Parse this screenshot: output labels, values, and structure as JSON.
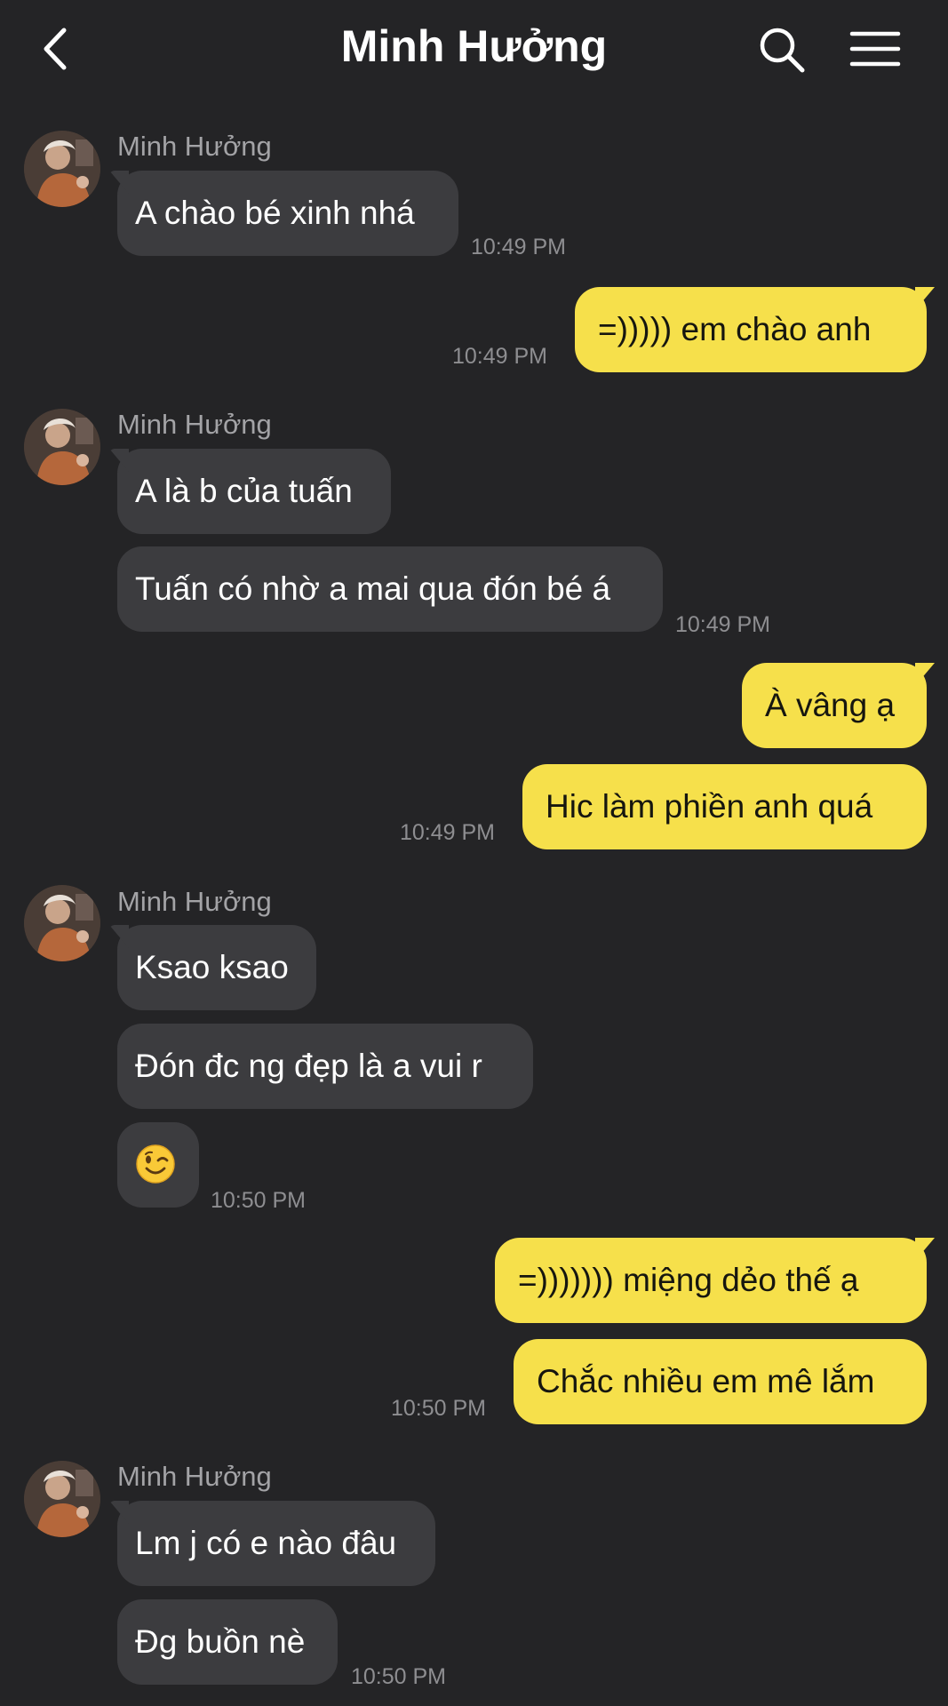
{
  "header": {
    "title": "Minh Hưởng",
    "back_icon": "chevron-left-icon",
    "search_icon": "search-icon",
    "menu_icon": "hamburger-menu-icon"
  },
  "colors": {
    "background": "#242426",
    "incoming_bubble": "#3c3c3f",
    "outgoing_bubble": "#f6e04b",
    "timestamp": "#8e8e91"
  },
  "messages": [
    {
      "sender": "Minh Hưởng",
      "text": "A chào bé xinh nhá",
      "time": "10:49 PM"
    },
    {
      "sender": "me",
      "text": "=))))) em chào anh",
      "time": "10:49 PM"
    },
    {
      "sender": "Minh Hưởng",
      "text": "A là b của tuấn"
    },
    {
      "sender": "Minh Hưởng",
      "text": "Tuấn có nhờ a mai qua đón bé á",
      "time": "10:49 PM"
    },
    {
      "sender": "me",
      "text": "À vâng ạ"
    },
    {
      "sender": "me",
      "text": "Hic làm phiền anh quá",
      "time": "10:49 PM"
    },
    {
      "sender": "Minh Hưởng",
      "text": "Ksao ksao"
    },
    {
      "sender": "Minh Hưởng",
      "text": "Đón đc ng đẹp là a vui r"
    },
    {
      "sender": "Minh Hưởng",
      "emoji": "winking-face-emoji",
      "time": "10:50 PM"
    },
    {
      "sender": "me",
      "text": "=))))))) miệng dẻo thế ạ"
    },
    {
      "sender": "me",
      "text": "Chắc nhiều em mê lắm",
      "time": "10:50 PM"
    },
    {
      "sender": "Minh Hưởng",
      "text": "Lm j có e nào đâu"
    },
    {
      "sender": "Minh Hưởng",
      "text": "Đg buồn nè",
      "time": "10:50 PM"
    }
  ]
}
